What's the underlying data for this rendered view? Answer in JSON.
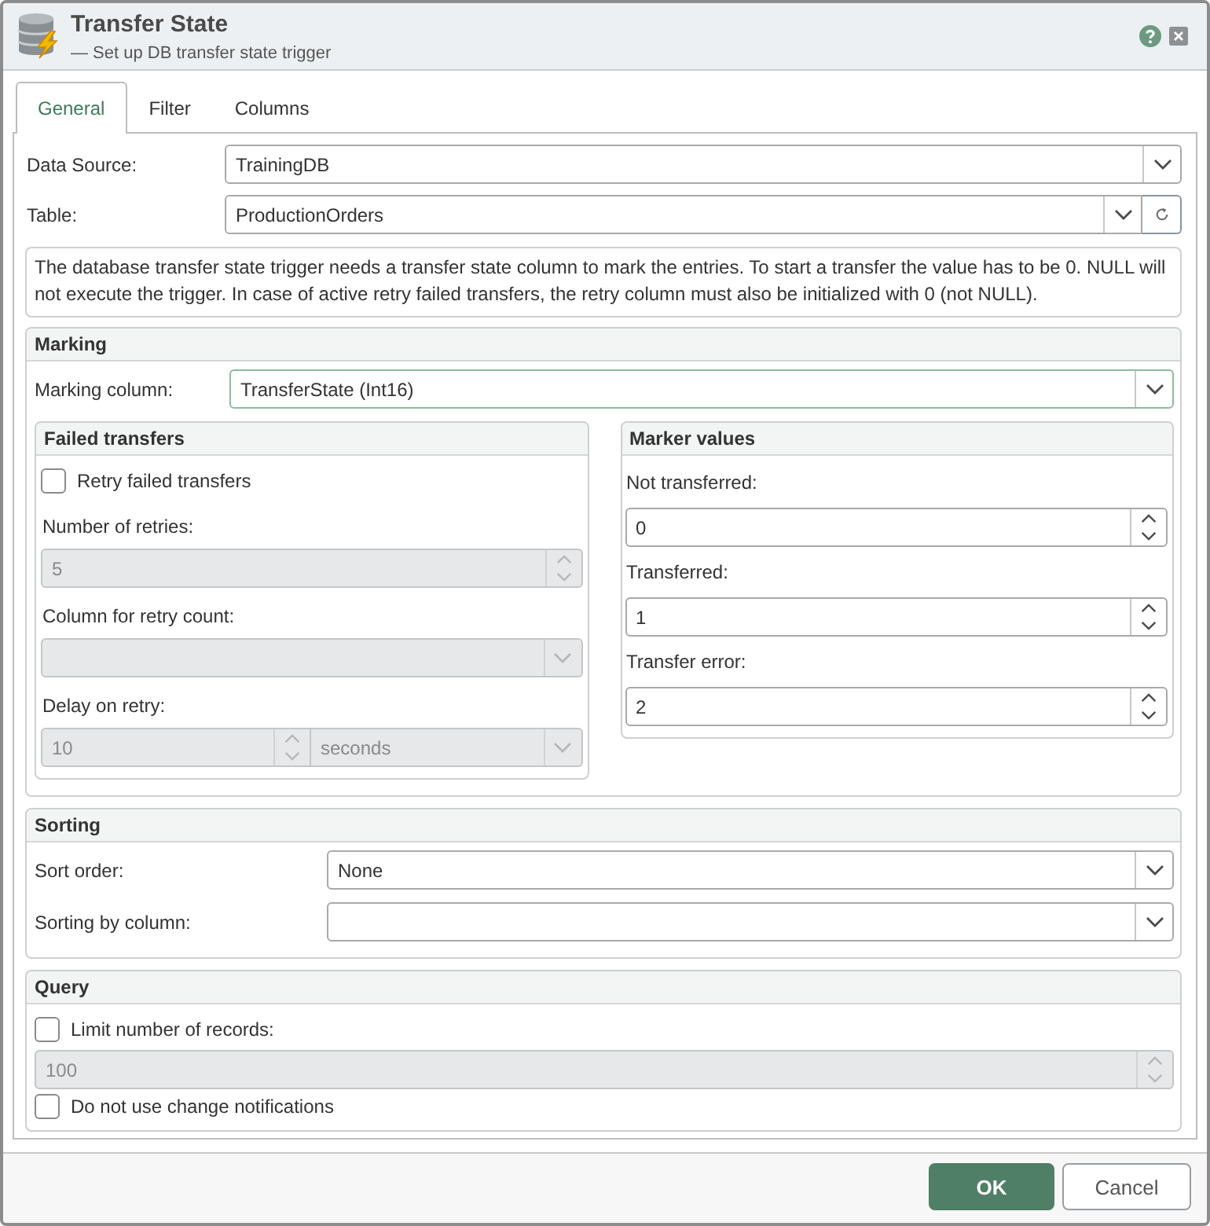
{
  "window": {
    "title": "Transfer State",
    "subtitle": "— Set up DB transfer state trigger"
  },
  "tabs": [
    {
      "label": "General",
      "selected": true
    },
    {
      "label": "Filter",
      "selected": false
    },
    {
      "label": "Columns",
      "selected": false
    }
  ],
  "general": {
    "fields": [
      {
        "label": "Data Source:",
        "value": "TrainingDB",
        "kind": "combo"
      },
      {
        "label": "Table:",
        "value": "ProductionOrders",
        "kind": "combo_refresh"
      }
    ],
    "info_text": "The database transfer state trigger needs a transfer state column to mark the entries. To start a transfer the value has to be 0. NULL will not execute the trigger. In case of active retry failed transfers, the retry column must also be initialized with 0 (not NULL).",
    "marking": {
      "title": "Marking",
      "marking_column": {
        "label": "Marking column:",
        "value": "TransferState (Int16)",
        "focused": true
      },
      "failed_transfers": {
        "title": "Failed transfers",
        "retry_checkbox": {
          "label": "Retry failed transfers",
          "checked": false
        },
        "number_of_retries": {
          "label": "Number of retries:",
          "value": "5",
          "disabled": true
        },
        "retry_count_column": {
          "label": "Column for retry count:",
          "disabled": true
        },
        "delay_on_retry": {
          "label": "Delay on retry:",
          "value": "10",
          "unit": "seconds",
          "disabled": true
        }
      },
      "marker_values": {
        "title": "Marker values",
        "fields": [
          {
            "label": "Not transferred:",
            "value": "0"
          },
          {
            "label": "Transferred:",
            "value": "1"
          },
          {
            "label": "Transfer error:",
            "value": "2"
          }
        ]
      }
    },
    "sorting": {
      "title": "Sorting",
      "fields": [
        {
          "label": "Sort order:",
          "value": "None"
        },
        {
          "label": "Sorting by column:"
        }
      ]
    },
    "query": {
      "title": "Query",
      "limit_checkbox": {
        "label": "Limit number of records:",
        "checked": false
      },
      "limit_value": {
        "value": "100",
        "disabled": true
      },
      "notifications_checkbox": {
        "label": "Do not use change notifications",
        "checked": false
      }
    }
  },
  "buttons": [
    {
      "label": "OK",
      "kind": "primary"
    },
    {
      "label": "Cancel",
      "kind": "secondary"
    }
  ]
}
